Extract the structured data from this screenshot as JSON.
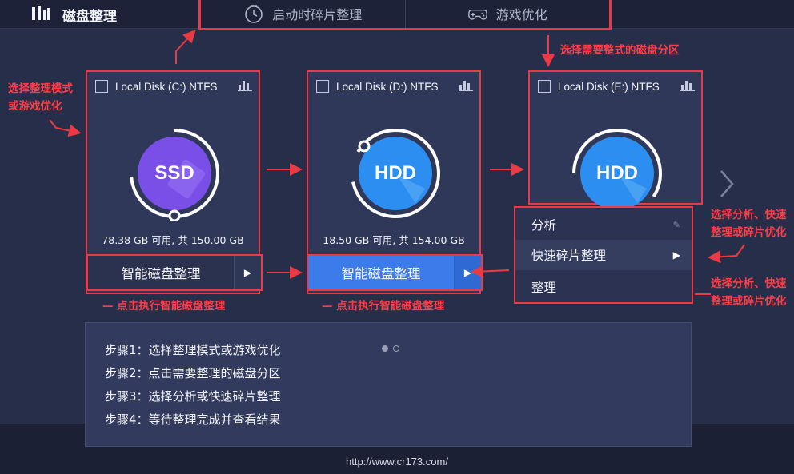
{
  "app": {
    "title": "磁盘整理",
    "logo_icon": "app-logo-icon"
  },
  "tabs": [
    {
      "label": "启动时碎片整理",
      "icon": "boot-clock-icon"
    },
    {
      "label": "游戏优化",
      "icon": "gamepad-icon"
    }
  ],
  "disks": [
    {
      "name": "Local Disk (C:) NTFS",
      "type": "SSD",
      "usage": "78.38 GB 可用, 共 150.00 GB",
      "color": "#7a4fe8"
    },
    {
      "name": "Local Disk (D:) NTFS",
      "type": "HDD",
      "usage": "18.50 GB 可用, 共 154.00 GB",
      "color": "#2b8ef0"
    },
    {
      "name": "Local Disk (E:) NTFS",
      "type": "HDD",
      "usage": "",
      "color": "#2b8ef0"
    }
  ],
  "run_button": {
    "label": "智能磁盘整理"
  },
  "dropdown_menu": {
    "items": [
      "分析",
      "快速碎片整理",
      "整理"
    ]
  },
  "annotations": {
    "select_mode": "选择整理模式\n或游戏优化",
    "select_partition": "选择需要整式的磁盘分区",
    "click_run_1": "— 点击执行智能磁盘整理",
    "click_run_2": "— 点击执行智能磁盘整理",
    "choose_analyze_1": "选择分析、快速\n整理或碎片优化",
    "choose_analyze_2": "选择分析、快速\n整理或碎片优化"
  },
  "steps": [
    "步骤1：选择整理模式或游戏优化",
    "步骤2：点击需要整理的磁盘分区",
    "步骤3：选择分析或快速碎片整理",
    "步骤4：等待整理完成并查看结果"
  ],
  "footer": {
    "url": "http://www.cr173.com/"
  },
  "colors": {
    "highlight": "#ea3a45",
    "ssd": "#7a4fe8",
    "hdd": "#2b8ef0",
    "button_blue": "#3b7bea"
  }
}
